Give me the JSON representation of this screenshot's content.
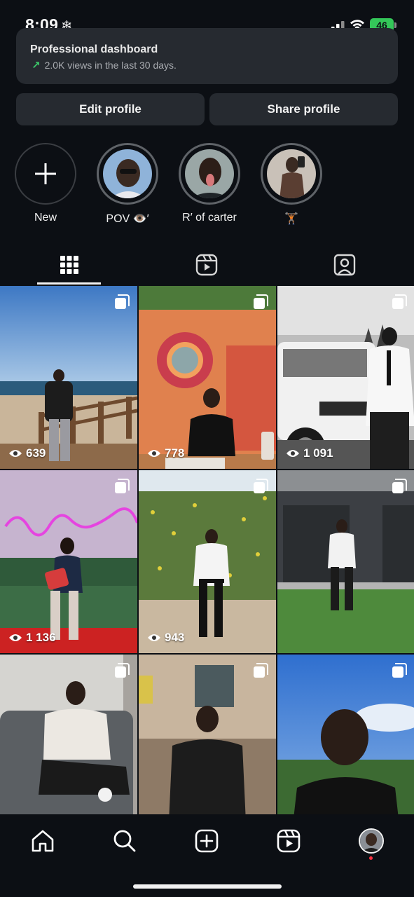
{
  "status": {
    "time": "8:09",
    "battery": "46"
  },
  "dashboard": {
    "title": "Professional dashboard",
    "subtitle": "2.0K views in the last 30 days."
  },
  "buttons": {
    "edit": "Edit profile",
    "share": "Share profile"
  },
  "highlights": [
    {
      "label": "New"
    },
    {
      "label": "POV 👁️′"
    },
    {
      "label": "R′ of carter"
    },
    {
      "label": "🏋🏾"
    }
  ],
  "tabs": [
    "posts-grid-icon",
    "reels-icon",
    "tagged-icon"
  ],
  "posts": [
    {
      "views": "639"
    },
    {
      "views": "778"
    },
    {
      "views": "1 091"
    },
    {
      "views": "1 136"
    },
    {
      "views": "943"
    },
    {
      "views": ""
    },
    {
      "views": ""
    },
    {
      "views": ""
    },
    {
      "views": ""
    }
  ],
  "colors": {
    "background": "#0c0f14",
    "card": "#262a30",
    "battery": "#34c759",
    "notification": "#ff3040"
  }
}
